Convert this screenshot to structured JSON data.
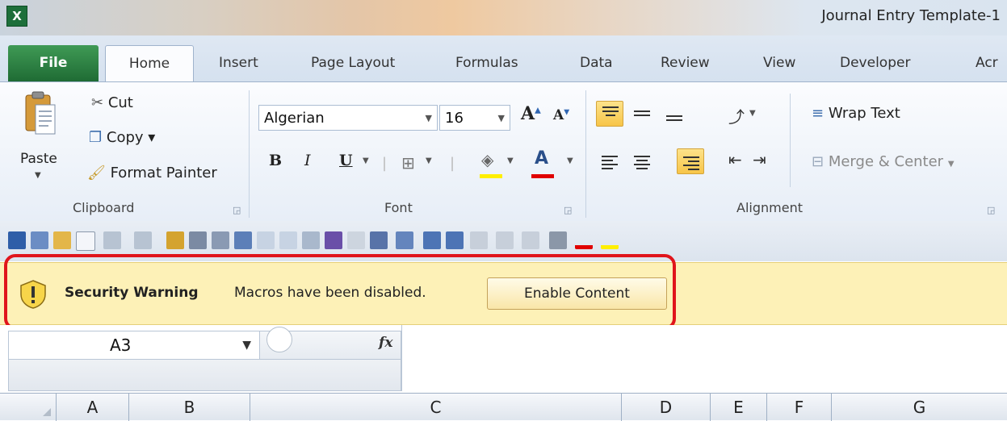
{
  "window": {
    "app_icon_letter": "X",
    "title": "Journal Entry Template-1"
  },
  "tabs": [
    "File",
    "Home",
    "Insert",
    "Page Layout",
    "Formulas",
    "Data",
    "Review",
    "View",
    "Developer",
    "Acr"
  ],
  "clipboard": {
    "paste": "Paste",
    "cut": "Cut",
    "copy": "Copy ▾",
    "format_painter": "Format Painter",
    "group_label": "Clipboard"
  },
  "font": {
    "name": "Algerian",
    "size": "16",
    "grow": "A",
    "shrink": "A",
    "bold": "B",
    "italic": "I",
    "underline": "U",
    "group_label": "Font",
    "fill_color": "#ffef00",
    "font_color": "#e00000"
  },
  "alignment": {
    "wrap_text": "Wrap Text",
    "merge_center": "Merge & Center",
    "group_label": "Alignment"
  },
  "security": {
    "title": "Security Warning",
    "message": "Macros have been disabled.",
    "button": "Enable Content"
  },
  "formula_bar": {
    "cell_ref": "A3",
    "fx": "fx"
  },
  "columns": [
    "A",
    "B",
    "C",
    "D",
    "E",
    "F",
    "G"
  ]
}
